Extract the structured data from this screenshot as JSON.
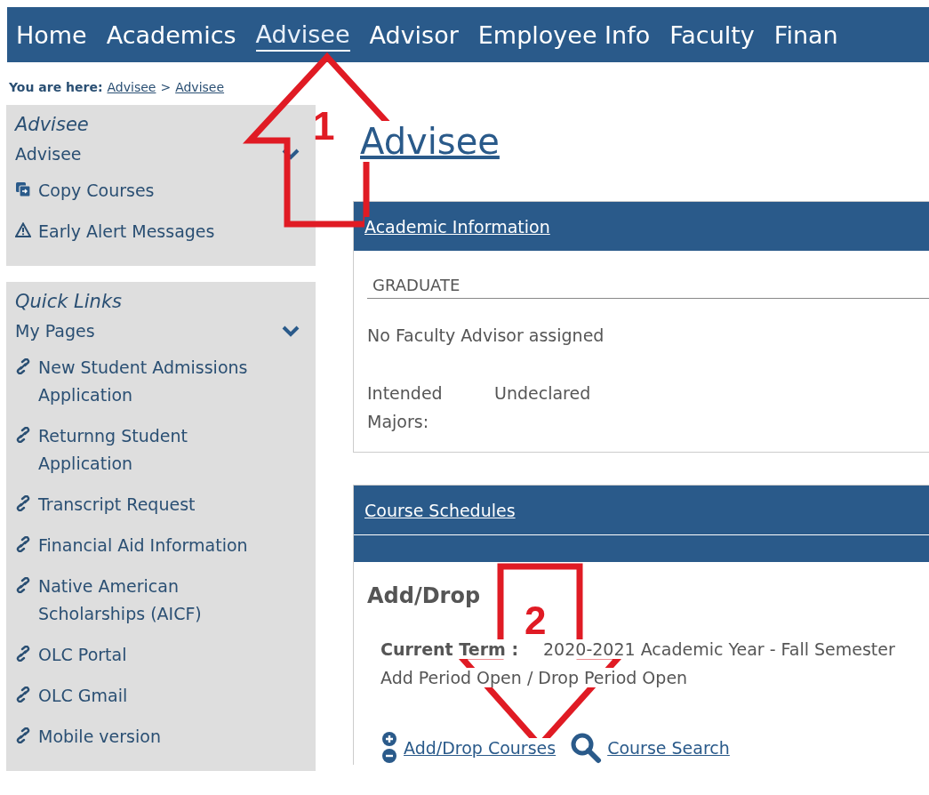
{
  "nav": {
    "items": [
      {
        "label": "Home",
        "selected": false
      },
      {
        "label": "Academics",
        "selected": false
      },
      {
        "label": "Advisee",
        "selected": true
      },
      {
        "label": "Advisor",
        "selected": false
      },
      {
        "label": "Employee Info",
        "selected": false
      },
      {
        "label": "Faculty",
        "selected": false
      },
      {
        "label": "Finan",
        "selected": false
      }
    ]
  },
  "breadcrumb": {
    "label": "You are here:",
    "links": [
      "Advisee",
      "Advisee"
    ],
    "separator": ">"
  },
  "sidebar": {
    "panels": [
      {
        "title": "Advisee",
        "items": [
          {
            "kind": "header",
            "label": "Advisee",
            "expanded": true
          },
          {
            "kind": "copy",
            "label": "Copy Courses"
          },
          {
            "kind": "alert",
            "label": "Early Alert Messages"
          }
        ]
      },
      {
        "title": "Quick Links",
        "items": [
          {
            "kind": "header",
            "label": "My Pages",
            "expanded": true
          },
          {
            "kind": "link",
            "label": "New Student Admissions Application"
          },
          {
            "kind": "link",
            "label": "Returnng Student Application"
          },
          {
            "kind": "link",
            "label": "Transcript Request"
          },
          {
            "kind": "link",
            "label": "Financial Aid Information"
          },
          {
            "kind": "link",
            "label": "Native American Scholarships (AICF)"
          },
          {
            "kind": "link",
            "label": "OLC Portal"
          },
          {
            "kind": "link",
            "label": "OLC Gmail"
          },
          {
            "kind": "link",
            "label": "Mobile version"
          }
        ]
      }
    ]
  },
  "page_title": "Advisee",
  "academic_information": {
    "header": "Academic Information",
    "level": "GRADUATE",
    "advisor": "No Faculty Advisor assigned",
    "majors_label": "Intended Majors:",
    "majors_value": "Undeclared"
  },
  "course_schedules": {
    "header": "Course Schedules",
    "section_title": "Add/Drop",
    "term_label": "Current Term :",
    "term_value": "2020-2021 Academic Year - Fall Semester",
    "period_status": "Add Period Open / Drop Period Open",
    "links": [
      {
        "kind": "adddrop",
        "label": "Add/Drop Courses"
      },
      {
        "kind": "search",
        "label": "Course Search"
      }
    ]
  },
  "annotations": [
    {
      "kind": "up",
      "label": "1"
    },
    {
      "kind": "down",
      "label": "2"
    }
  ]
}
